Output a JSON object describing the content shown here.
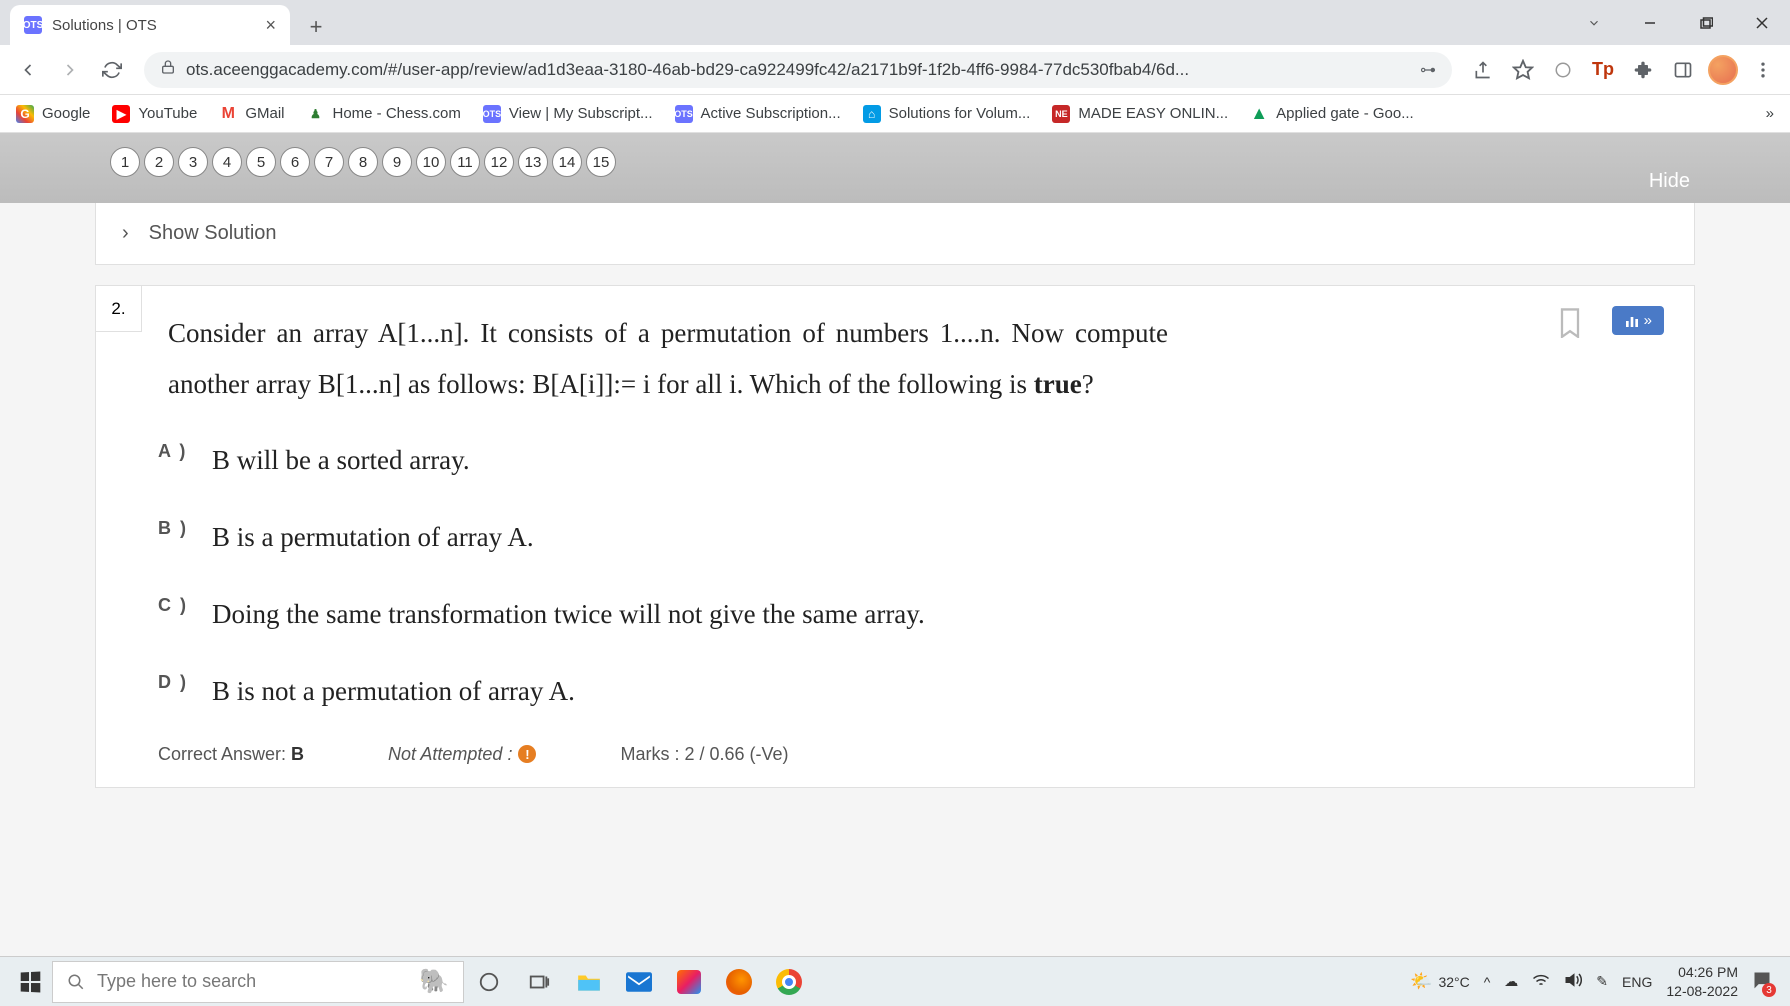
{
  "browser": {
    "tab_title": "Solutions | OTS",
    "tab_favicon": "OTS",
    "url": "ots.aceenggacademy.com/#/user-app/review/ad1d3eaa-3180-46ab-bd29-ca922499fc42/a2171b9f-1f2b-4ff6-9984-77dc530fbab4/6d...",
    "bookmarks": [
      {
        "label": "Google",
        "color": "#fff"
      },
      {
        "label": "YouTube",
        "color": "#f00"
      },
      {
        "label": "GMail",
        "color": "#ea4335"
      },
      {
        "label": "Home - Chess.com",
        "color": "#2e7d32"
      },
      {
        "label": "View | My Subscript...",
        "color": "#6b73ff"
      },
      {
        "label": "Active Subscription...",
        "color": "#6b73ff"
      },
      {
        "label": "Solutions for Volum...",
        "color": "#039be5"
      },
      {
        "label": "MADE EASY ONLIN...",
        "color": "#c62828"
      },
      {
        "label": "Applied gate - Goo...",
        "color": "#0f9d58"
      }
    ]
  },
  "page": {
    "question_numbers": [
      "1",
      "2",
      "3",
      "4",
      "5",
      "6",
      "7",
      "8",
      "9",
      "10",
      "11",
      "12",
      "13",
      "14",
      "15"
    ],
    "active_q_index": 1,
    "hide_label": "Hide",
    "show_solution": "Show Solution",
    "question_number": "2.",
    "question_text_1": "Consider an array A[1...n]. It consists of a permutation of numbers 1....n. Now compute another array B[1...n] as follows: B[A[i]]:= i for all i. Which of the following is ",
    "question_bold": "true",
    "question_tail": "?",
    "options": [
      {
        "label": "A )",
        "text": "B will be a sorted array."
      },
      {
        "label": "B )",
        "text": "B is a permutation of array A."
      },
      {
        "label": "C )",
        "text": "Doing the same transformation twice will not give the same array."
      },
      {
        "label": "D )",
        "text": "B is not a permutation of array A."
      }
    ],
    "correct_label": "Correct Answer: ",
    "correct_value": "B",
    "not_attempted": "Not Attempted :",
    "marks": "Marks : 2 / 0.66 (-Ve)"
  },
  "taskbar": {
    "search_placeholder": "Type here to search",
    "temp": "32°C",
    "lang": "ENG",
    "time": "04:26 PM",
    "date": "12-08-2022",
    "notif_count": "3"
  }
}
